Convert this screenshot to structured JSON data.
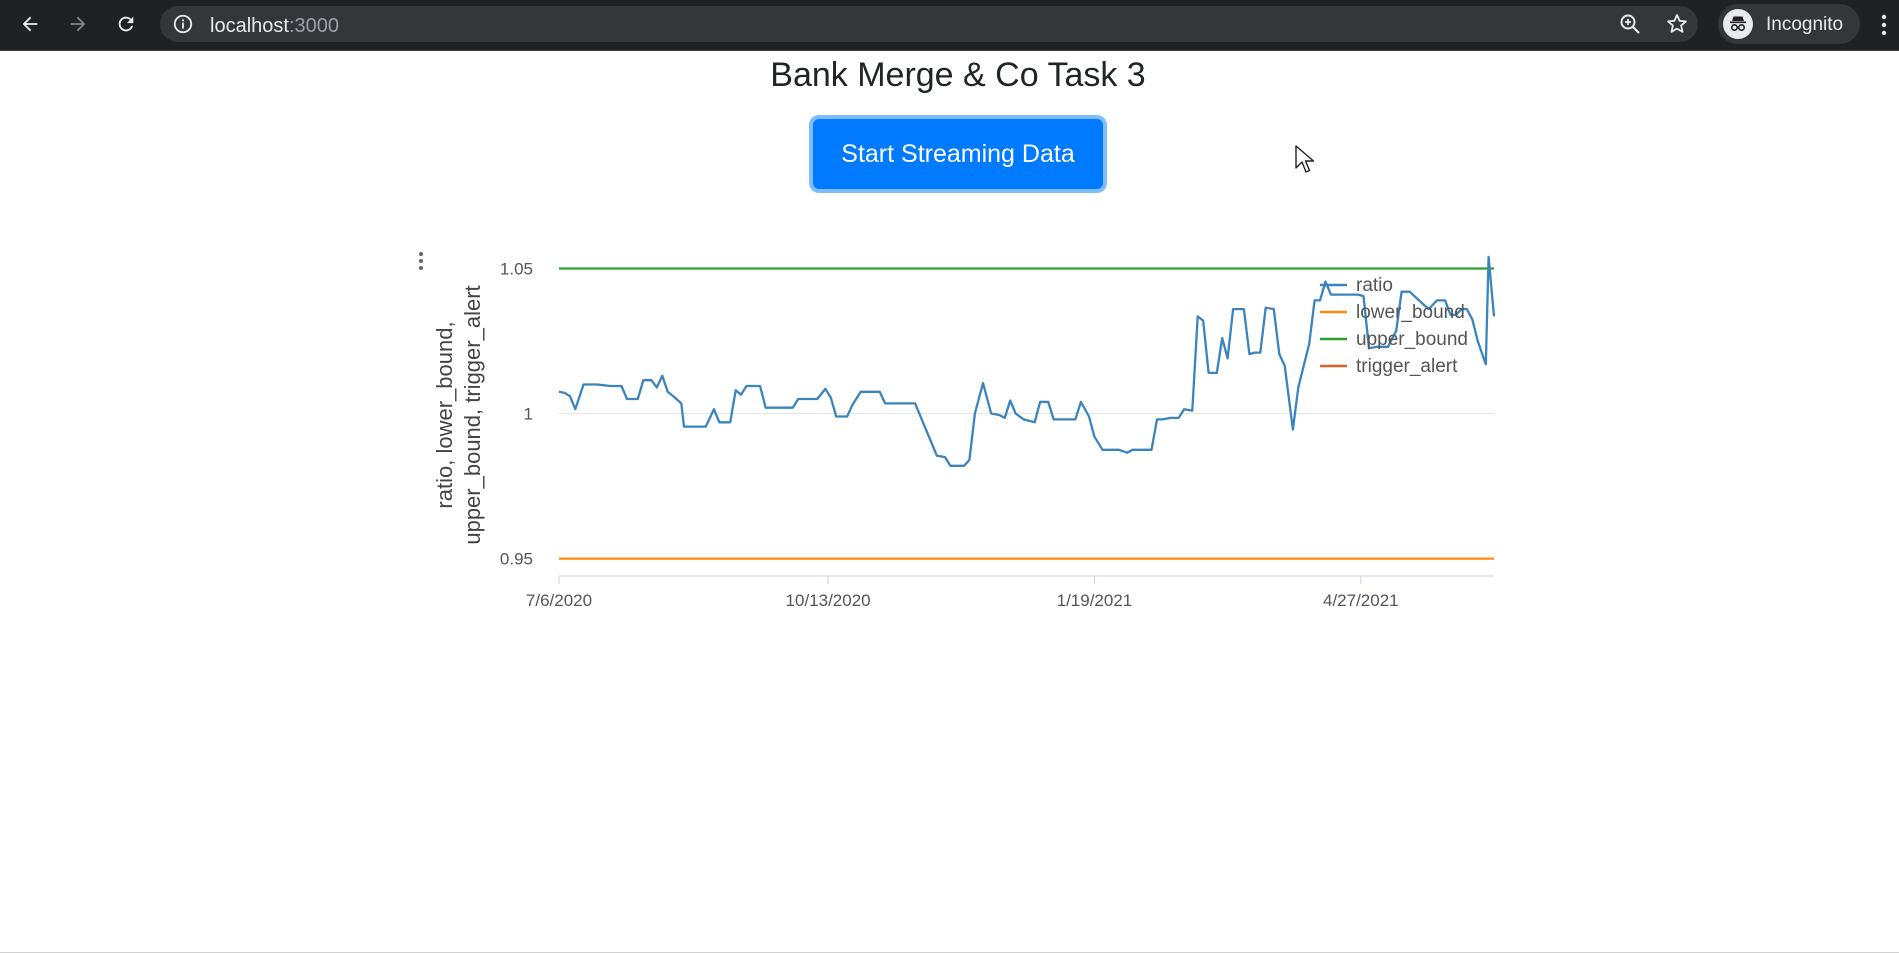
{
  "browser": {
    "url_host": "localhost",
    "url_port": ":3000",
    "profile_label": "Incognito"
  },
  "page": {
    "title": "Bank Merge & Co Task 3",
    "stream_button_label": "Start Streaming Data"
  },
  "icons": {
    "back": "arrow-left-icon",
    "forward": "arrow-right-icon",
    "reload": "reload-icon",
    "site_info": "info-icon",
    "zoom": "zoom-icon",
    "bookmark": "star-icon",
    "incognito": "incognito-icon",
    "menu": "kebab-menu-icon",
    "chart_menu": "kebab-menu-icon",
    "cursor": "mouse-pointer-icon"
  },
  "chart_data": {
    "type": "line",
    "title": "",
    "xlabel": "",
    "ylabel": "ratio, lower_bound, upper_bound, trigger_alert",
    "ylabel_lines": [
      "ratio, lower_bound,",
      "upper_bound, trigger_alert"
    ],
    "x_tick_labels": [
      "7/6/2020",
      "10/13/2020",
      "1/19/2021",
      "4/27/2021"
    ],
    "y_tick_labels": [
      "0.95",
      "1",
      "1.05"
    ],
    "y_ticks": [
      0.95,
      1.0,
      1.05
    ],
    "xlim": [
      "2020-07-06",
      "2021-06-15"
    ],
    "ylim": [
      0.944,
      1.055
    ],
    "grid": true,
    "legend_position": "top-right",
    "series": [
      {
        "name": "ratio",
        "color": "#3b84be",
        "points": [
          [
            "2020-07-06",
            1.0075
          ],
          [
            "2020-07-08",
            1.0072
          ],
          [
            "2020-07-10",
            1.006
          ],
          [
            "2020-07-12",
            1.0015
          ],
          [
            "2020-07-15",
            1.01
          ],
          [
            "2020-07-20",
            1.01
          ],
          [
            "2020-07-25",
            1.0095
          ],
          [
            "2020-07-29",
            1.0095
          ],
          [
            "2020-07-31",
            1.005
          ],
          [
            "2020-08-04",
            1.005
          ],
          [
            "2020-08-06",
            1.0115
          ],
          [
            "2020-08-09",
            1.0115
          ],
          [
            "2020-08-11",
            1.009
          ],
          [
            "2020-08-13",
            1.013
          ],
          [
            "2020-08-15",
            1.0075
          ],
          [
            "2020-08-17",
            1.006
          ],
          [
            "2020-08-20",
            1.0035
          ],
          [
            "2020-08-21",
            0.9955
          ],
          [
            "2020-08-26",
            0.9955
          ],
          [
            "2020-08-29",
            0.9955
          ],
          [
            "2020-09-01",
            1.0015
          ],
          [
            "2020-09-03",
            0.997
          ],
          [
            "2020-09-07",
            0.997
          ],
          [
            "2020-09-09",
            1.008
          ],
          [
            "2020-09-11",
            1.0065
          ],
          [
            "2020-09-13",
            1.0095
          ],
          [
            "2020-09-18",
            1.0095
          ],
          [
            "2020-09-20",
            1.002
          ],
          [
            "2020-09-25",
            1.002
          ],
          [
            "2020-09-30",
            1.002
          ],
          [
            "2020-10-02",
            1.005
          ],
          [
            "2020-10-06",
            1.005
          ],
          [
            "2020-10-09",
            1.005
          ],
          [
            "2020-10-12",
            1.0085
          ],
          [
            "2020-10-14",
            1.0055
          ],
          [
            "2020-10-16",
            0.999
          ],
          [
            "2020-10-20",
            0.999
          ],
          [
            "2020-10-22",
            1.003
          ],
          [
            "2020-10-25",
            1.0075
          ],
          [
            "2020-10-29",
            1.0075
          ],
          [
            "2020-11-01",
            1.0075
          ],
          [
            "2020-11-03",
            1.0035
          ],
          [
            "2020-11-08",
            1.0035
          ],
          [
            "2020-11-14",
            1.0035
          ],
          [
            "2020-11-22",
            0.9855
          ],
          [
            "2020-11-25",
            0.985
          ],
          [
            "2020-11-27",
            0.982
          ],
          [
            "2020-12-02",
            0.982
          ],
          [
            "2020-12-04",
            0.984
          ],
          [
            "2020-12-06",
            1.0
          ],
          [
            "2020-12-09",
            1.0105
          ],
          [
            "2020-12-12",
            1.0
          ],
          [
            "2020-12-15",
            0.9995
          ],
          [
            "2020-12-17",
            0.9985
          ],
          [
            "2020-12-19",
            1.0045
          ],
          [
            "2020-12-21",
            1.0
          ],
          [
            "2020-12-24",
            0.998
          ],
          [
            "2020-12-28",
            0.997
          ],
          [
            "2020-12-30",
            1.004
          ],
          [
            "2021-01-02",
            1.004
          ],
          [
            "2021-01-04",
            0.998
          ],
          [
            "2021-01-09",
            0.998
          ],
          [
            "2021-01-12",
            0.998
          ],
          [
            "2021-01-14",
            1.004
          ],
          [
            "2021-01-17",
            0.999
          ],
          [
            "2021-01-19",
            0.992
          ],
          [
            "2021-01-22",
            0.9875
          ],
          [
            "2021-01-28",
            0.9875
          ],
          [
            "2021-01-31",
            0.9865
          ],
          [
            "2021-02-02",
            0.9875
          ],
          [
            "2021-02-06",
            0.9875
          ],
          [
            "2021-02-09",
            0.9875
          ],
          [
            "2021-02-11",
            0.998
          ],
          [
            "2021-02-13",
            0.998
          ],
          [
            "2021-02-16",
            0.9985
          ],
          [
            "2021-02-19",
            0.9985
          ],
          [
            "2021-02-21",
            1.0015
          ],
          [
            "2021-02-24",
            1.001
          ],
          [
            "2021-02-26",
            1.0335
          ],
          [
            "2021-02-28",
            1.032
          ],
          [
            "2021-03-02",
            1.014
          ],
          [
            "2021-03-05",
            1.014
          ],
          [
            "2021-03-07",
            1.026
          ],
          [
            "2021-03-09",
            1.019
          ],
          [
            "2021-03-11",
            1.036
          ],
          [
            "2021-03-15",
            1.036
          ],
          [
            "2021-03-17",
            1.0205
          ],
          [
            "2021-03-19",
            1.021
          ],
          [
            "2021-03-21",
            1.021
          ],
          [
            "2021-03-23",
            1.0365
          ],
          [
            "2021-03-26",
            1.036
          ],
          [
            "2021-03-28",
            1.0205
          ],
          [
            "2021-03-30",
            1.0165
          ],
          [
            "2021-04-02",
            0.9945
          ],
          [
            "2021-04-04",
            1.009
          ],
          [
            "2021-04-08",
            1.024
          ],
          [
            "2021-04-10",
            1.039
          ],
          [
            "2021-04-12",
            1.039
          ],
          [
            "2021-04-14",
            1.0455
          ],
          [
            "2021-04-16",
            1.041
          ],
          [
            "2021-04-20",
            1.041
          ],
          [
            "2021-04-26",
            1.041
          ],
          [
            "2021-04-28",
            1.0405
          ],
          [
            "2021-04-30",
            1.0225
          ],
          [
            "2021-05-03",
            1.023
          ],
          [
            "2021-05-07",
            1.023
          ],
          [
            "2021-05-10",
            1.0285
          ],
          [
            "2021-05-12",
            1.042
          ],
          [
            "2021-05-15",
            1.042
          ],
          [
            "2021-05-19",
            1.0385
          ],
          [
            "2021-05-22",
            1.036
          ],
          [
            "2021-05-25",
            1.039
          ],
          [
            "2021-05-28",
            1.039
          ],
          [
            "2021-05-30",
            1.034
          ],
          [
            "2021-06-01",
            1.034
          ],
          [
            "2021-06-03",
            1.036
          ],
          [
            "2021-06-05",
            1.036
          ],
          [
            "2021-06-07",
            1.0325
          ],
          [
            "2021-06-09",
            1.025
          ],
          [
            "2021-06-12",
            1.017
          ],
          [
            "2021-06-13",
            1.054
          ],
          [
            "2021-06-15",
            1.0335
          ]
        ]
      },
      {
        "name": "lower_bound",
        "color": "#ff8a14",
        "y": 0.95
      },
      {
        "name": "upper_bound",
        "color": "#2ca02c",
        "y": 1.05
      },
      {
        "name": "trigger_alert",
        "color": "#d9622b",
        "y": null
      }
    ]
  }
}
